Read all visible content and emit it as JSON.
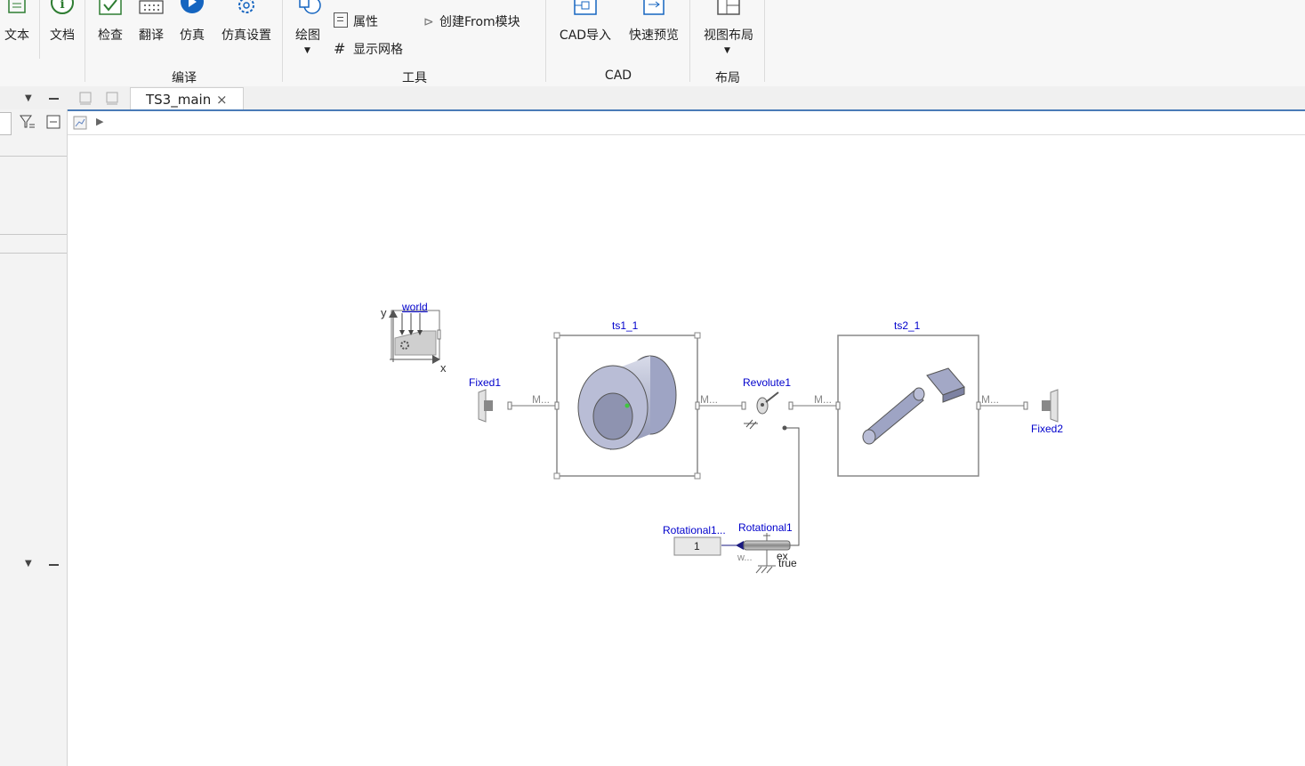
{
  "ribbon": {
    "buttons": [
      {
        "label": "文本",
        "icon": "text-icon"
      },
      {
        "label": "文档",
        "icon": "info-icon"
      },
      {
        "label": "检查",
        "icon": "check-icon"
      },
      {
        "label": "翻译",
        "icon": "translate-icon"
      },
      {
        "label": "仿真",
        "icon": "play-icon"
      },
      {
        "label": "仿真设置",
        "icon": "gear-icon"
      },
      {
        "label": "绘图",
        "icon": "draw-icon"
      },
      {
        "label": "CAD导入",
        "icon": "cad-import-icon"
      },
      {
        "label": "快速预览",
        "icon": "preview-icon"
      },
      {
        "label": "视图布局",
        "icon": "layout-icon"
      }
    ],
    "small_items": {
      "properties": "属性",
      "show_grid": "显示网格",
      "create_from": "创建From模块"
    },
    "groups": {
      "compile": "编译",
      "tools": "工具",
      "cad": "CAD",
      "layout": "布局"
    }
  },
  "tab": {
    "label": "TS3_main",
    "close": "×"
  },
  "diagram": {
    "world": {
      "label": "world",
      "axis_y": "y",
      "axis_x": "x"
    },
    "fixed1": "Fixed1",
    "fixed2": "Fixed2",
    "ts1": "ts1_1",
    "ts2": "ts2_1",
    "revolute": "Revolute1",
    "rotational": "Rotational1",
    "rotational_src": "Rotational1...",
    "const_value": "1",
    "port_m": "M...",
    "port_w": "w...",
    "port_ex": "ex",
    "port_true": "true"
  },
  "colors": {
    "accent": "#4a7bb7",
    "label_blue": "#0000cc",
    "solid_fill": "#9ea4c4"
  }
}
